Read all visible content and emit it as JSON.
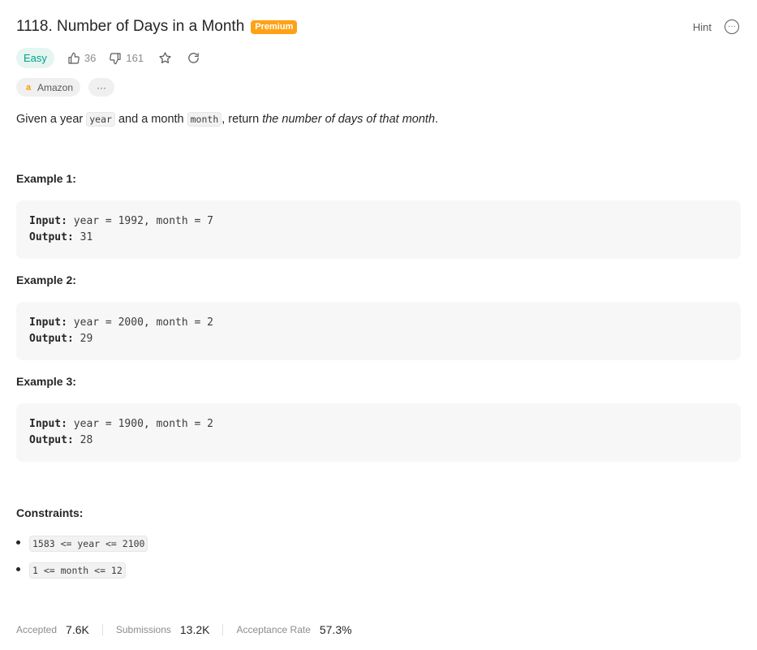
{
  "problem": {
    "title": "1118. Number of Days in a Month",
    "premium_label": "Premium",
    "difficulty": "Easy",
    "likes": "36",
    "dislikes": "161"
  },
  "toolbar": {
    "hint_label": "Hint"
  },
  "tags": {
    "company": "Amazon",
    "more": "···"
  },
  "description": {
    "part1": "Given a year ",
    "code1": "year",
    "part2": " and a month ",
    "code2": "month",
    "part3": ", return ",
    "emphasis": "the number of days of that month",
    "part4": "."
  },
  "examples": [
    {
      "title": "Example 1:",
      "input_label": "Input:",
      "input": "year = 1992, month = 7",
      "output_label": "Output:",
      "output": "31"
    },
    {
      "title": "Example 2:",
      "input_label": "Input:",
      "input": "year = 2000, month = 2",
      "output_label": "Output:",
      "output": "29"
    },
    {
      "title": "Example 3:",
      "input_label": "Input:",
      "input": "year = 1900, month = 2",
      "output_label": "Output:",
      "output": "28"
    }
  ],
  "constraints": {
    "title": "Constraints:",
    "items": [
      "1583 <= year <= 2100",
      "1 <= month <= 12"
    ]
  },
  "stats": {
    "accepted_label": "Accepted",
    "accepted_value": "7.6K",
    "submissions_label": "Submissions",
    "submissions_value": "13.2K",
    "rate_label": "Acceptance Rate",
    "rate_value": "57.3%"
  },
  "colors": {
    "accent": "#ffa116",
    "easy": "#00a288",
    "amazon": "#ff9900"
  },
  "icons": [
    "thumbs-up-icon",
    "thumbs-down-icon",
    "star-icon",
    "refresh-icon",
    "more-icon",
    "amazon-logo-icon"
  ]
}
